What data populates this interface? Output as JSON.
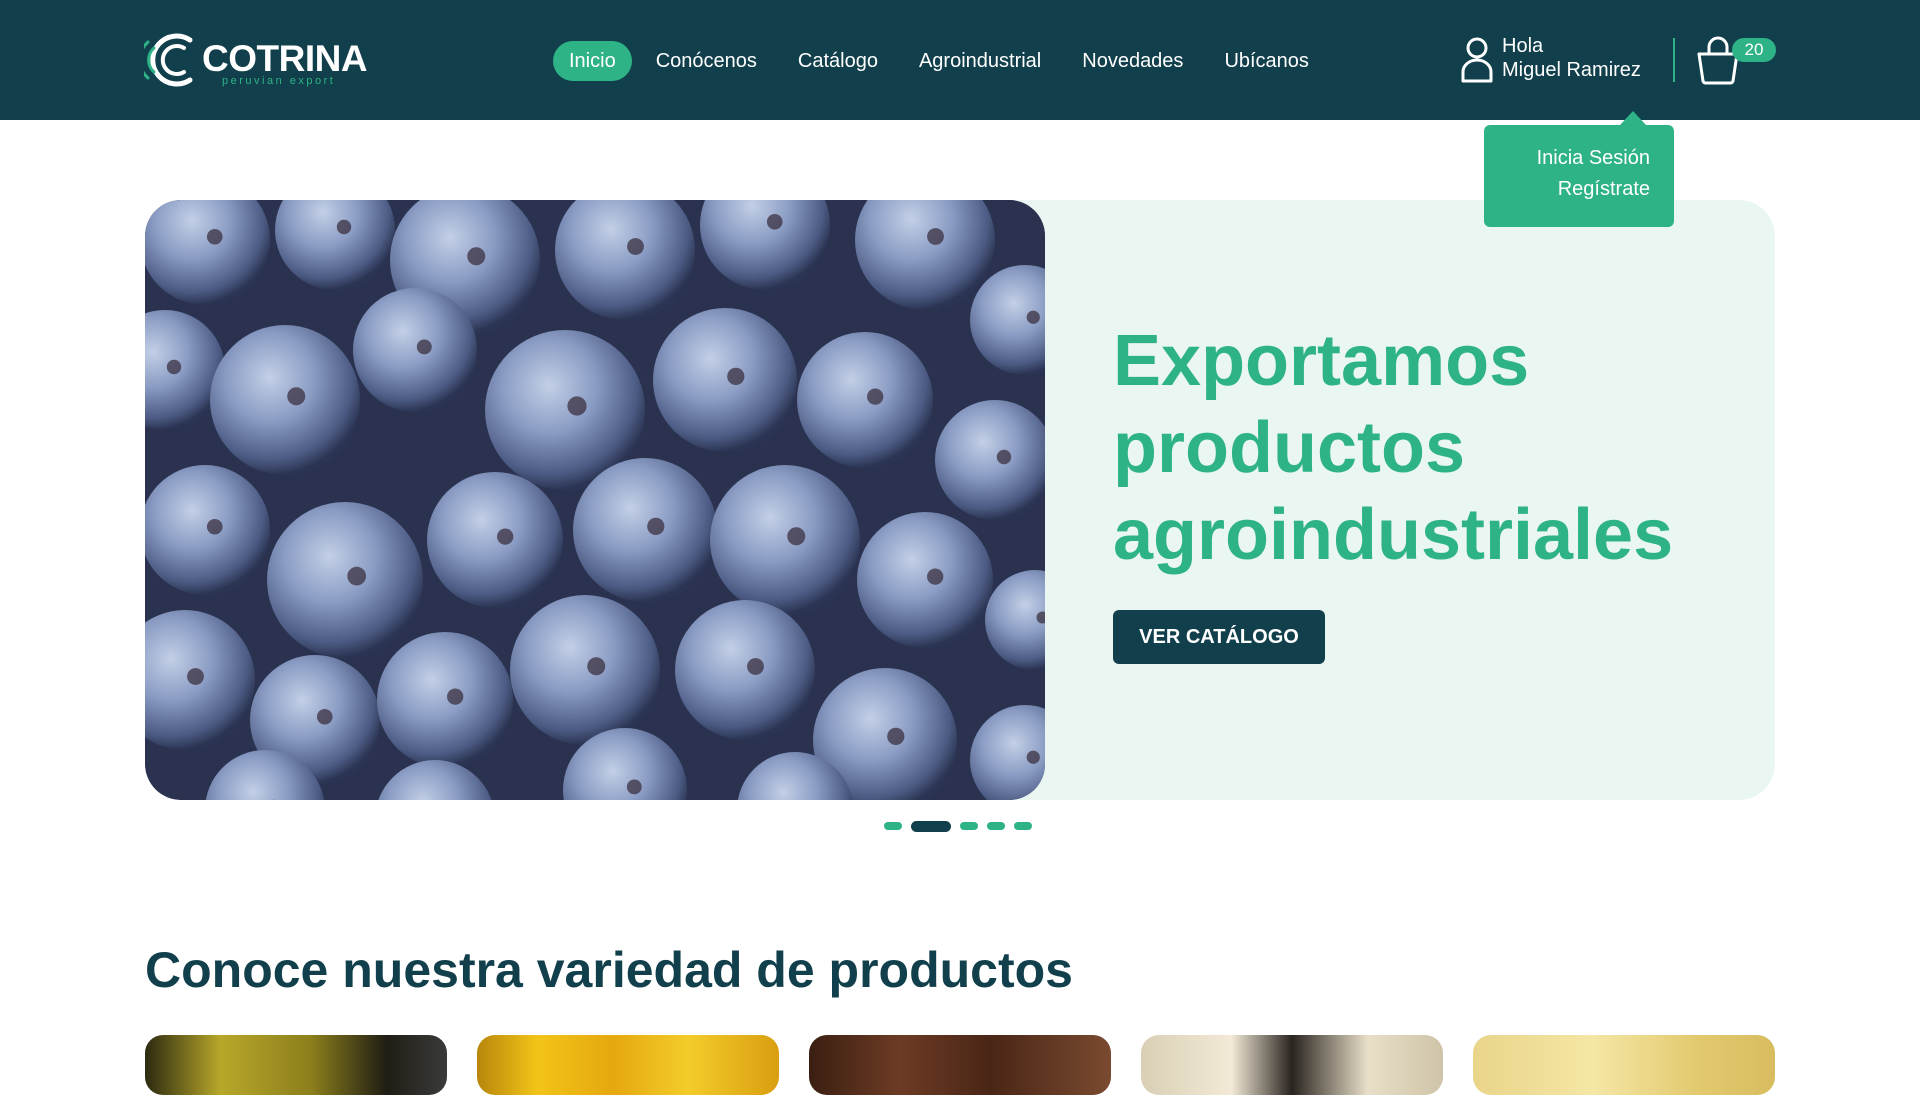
{
  "brand": {
    "name": "COTRINA",
    "tagline": "peruvian export"
  },
  "nav": [
    {
      "label": "Inicio",
      "active": true
    },
    {
      "label": "Conócenos",
      "active": false
    },
    {
      "label": "Catálogo",
      "active": false
    },
    {
      "label": "Agroindustrial",
      "active": false
    },
    {
      "label": "Novedades",
      "active": false
    },
    {
      "label": "Ubícanos",
      "active": false
    }
  ],
  "user": {
    "greeting": "Hola",
    "name": "Miguel Ramirez",
    "icon": "user-icon"
  },
  "cart": {
    "count": "20",
    "icon": "shopping-bag-icon"
  },
  "account_menu": {
    "login": "Inicia Sesión",
    "register": "Regístrate"
  },
  "hero": {
    "title_lines": [
      "Exportamos",
      "productos",
      "agroindustriales"
    ],
    "button": "VER CATÁLOGO",
    "image": "blueberries-photo",
    "slides_total": 5,
    "active_slide": 2
  },
  "products_section": {
    "title": "Conoce nuestra variedad de productos",
    "cards": [
      "olives-photo",
      "bananas-photo",
      "cacao-beans-photo",
      "black-eyed-peas-photo",
      "corn-photo"
    ]
  },
  "colors": {
    "primary": "#113f4b",
    "accent": "#2eb386",
    "hero_bg": "#eaf6f1"
  }
}
